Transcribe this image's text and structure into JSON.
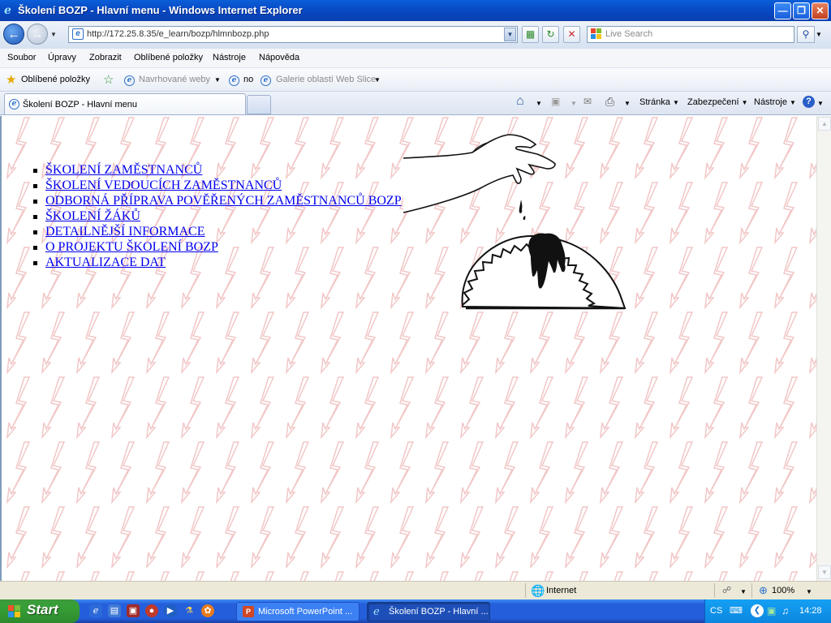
{
  "window": {
    "title": "Školení BOZP - Hlavní menu - Windows Internet Explorer"
  },
  "navigation": {
    "address": "http://172.25.8.35/e_learn/bozp/hlmnbozp.php",
    "search_placeholder": "Live Search"
  },
  "menubar": [
    "Soubor",
    "Úpravy",
    "Zobrazit",
    "Oblíbené položky",
    "Nástroje",
    "Nápověda"
  ],
  "favorites": {
    "favorites_label": "Oblíbené položky",
    "suggested_sites": "Navrhované weby",
    "no_item": "no",
    "web_slice": "Galerie oblastí Web Slice"
  },
  "tabs": {
    "active_title": "Školení BOZP - Hlavní menu"
  },
  "commandbar": {
    "page": "Stránka",
    "safety": "Zabezpečení",
    "tools": "Nástroje"
  },
  "content": {
    "menu_items": [
      "ŠKOLENÍ ZAMĚSTNANCŮ",
      "ŠKOLENÍ VEDOUCÍCH ZAMĚSTNANCŮ",
      "ODBORNÁ PŘÍPRAVA POVĚŘENÝCH ZAMĚSTNANCŮ BOZP",
      "ŠKOLENÍ ŽÁKŮ",
      "DETAILNĚJŠÍ INFORMACE",
      "O PROJEKTU ŠKOLENÍ BOZP",
      "AKTUALIZACE DAT"
    ],
    "background_color": "#f7dede"
  },
  "statusbar": {
    "zone": "Internet",
    "zoom": "100%"
  },
  "taskbar": {
    "start": "Start",
    "tasks": [
      "Microsoft PowerPoint ...",
      "Školení BOZP - Hlavní ..."
    ],
    "language": "CS",
    "clock": "14:28"
  }
}
